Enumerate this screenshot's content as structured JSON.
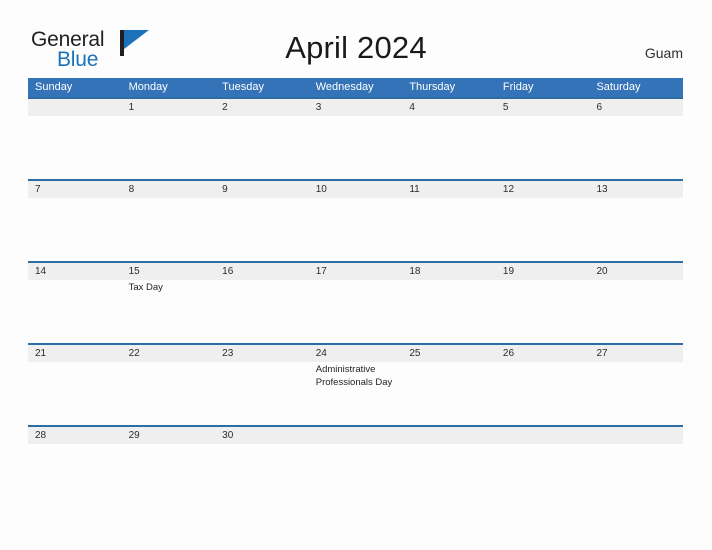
{
  "brand": {
    "word_general": "General",
    "word_blue": "Blue",
    "flag_icon": "flag-icon",
    "accent_color": "#1b72bb"
  },
  "header": {
    "title": "April 2024",
    "location": "Guam"
  },
  "colors": {
    "header_band": "#3573b8",
    "row_divider": "#2e6da4",
    "date_band": "#efefef",
    "page_background": "#fdfdfd"
  },
  "calendar": {
    "weekdays": [
      "Sunday",
      "Monday",
      "Tuesday",
      "Wednesday",
      "Thursday",
      "Friday",
      "Saturday"
    ],
    "weeks": [
      {
        "days": [
          {
            "date": "",
            "event": ""
          },
          {
            "date": "1",
            "event": ""
          },
          {
            "date": "2",
            "event": ""
          },
          {
            "date": "3",
            "event": ""
          },
          {
            "date": "4",
            "event": ""
          },
          {
            "date": "5",
            "event": ""
          },
          {
            "date": "6",
            "event": ""
          }
        ]
      },
      {
        "days": [
          {
            "date": "7",
            "event": ""
          },
          {
            "date": "8",
            "event": ""
          },
          {
            "date": "9",
            "event": ""
          },
          {
            "date": "10",
            "event": ""
          },
          {
            "date": "11",
            "event": ""
          },
          {
            "date": "12",
            "event": ""
          },
          {
            "date": "13",
            "event": ""
          }
        ]
      },
      {
        "days": [
          {
            "date": "14",
            "event": ""
          },
          {
            "date": "15",
            "event": "Tax Day"
          },
          {
            "date": "16",
            "event": ""
          },
          {
            "date": "17",
            "event": ""
          },
          {
            "date": "18",
            "event": ""
          },
          {
            "date": "19",
            "event": ""
          },
          {
            "date": "20",
            "event": ""
          }
        ]
      },
      {
        "days": [
          {
            "date": "21",
            "event": ""
          },
          {
            "date": "22",
            "event": ""
          },
          {
            "date": "23",
            "event": ""
          },
          {
            "date": "24",
            "event": "Administrative Professionals Day"
          },
          {
            "date": "25",
            "event": ""
          },
          {
            "date": "26",
            "event": ""
          },
          {
            "date": "27",
            "event": ""
          }
        ]
      },
      {
        "days": [
          {
            "date": "28",
            "event": ""
          },
          {
            "date": "29",
            "event": ""
          },
          {
            "date": "30",
            "event": ""
          },
          {
            "date": "",
            "event": ""
          },
          {
            "date": "",
            "event": ""
          },
          {
            "date": "",
            "event": ""
          },
          {
            "date": "",
            "event": ""
          }
        ]
      }
    ]
  }
}
